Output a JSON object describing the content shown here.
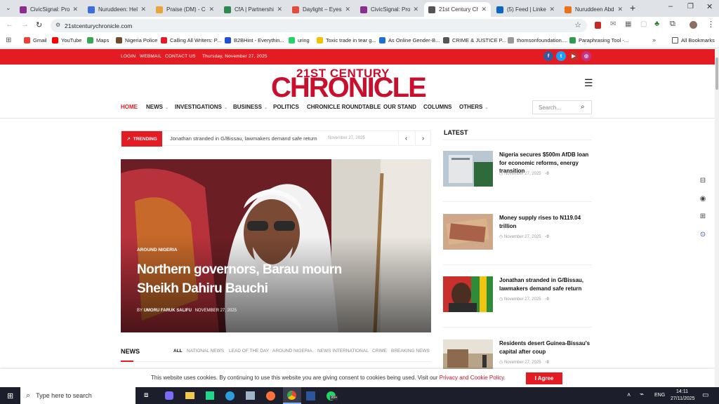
{
  "browser": {
    "tabs": [
      {
        "title": "CivicSignal: Proje",
        "color": "#8b2c8f"
      },
      {
        "title": "Nuruddeen: Help",
        "color": "#3b6de0"
      },
      {
        "title": "Praise (DM) - Coo",
        "color": "#e8a43a"
      },
      {
        "title": "CfA | Partnership:",
        "color": "#2c8a4e"
      },
      {
        "title": "Daylight – Eyes o",
        "color": "#e44b3a"
      },
      {
        "title": "CivicSignal: Proje",
        "color": "#8b2c8f"
      },
      {
        "title": "21st Century Chro",
        "color": "#555555"
      },
      {
        "title": "(5) Feed | LinkedIn",
        "color": "#0a66c2"
      },
      {
        "title": "Nuruddeen Abda",
        "color": "#e8731a"
      }
    ],
    "url": "21stcenturychronicle.com",
    "bookmarks": [
      {
        "label": "Gmail",
        "color": "#ea4335"
      },
      {
        "label": "YouTube",
        "color": "#ff0000"
      },
      {
        "label": "Maps",
        "color": "#34a853"
      },
      {
        "label": "Nigeria Police",
        "color": "#6d4c2a"
      },
      {
        "label": "Calling All Writers: P...",
        "color": "#e31b23"
      },
      {
        "label": "B2BHint - Everythin...",
        "color": "#2251d6"
      },
      {
        "label": "uring",
        "color": "#25d366"
      },
      {
        "label": "Toxic trade in tear g...",
        "color": "#f2c200"
      },
      {
        "label": "As Online Gender-B...",
        "color": "#1d6fd1"
      },
      {
        "label": "CRIME & JUSTICE P...",
        "color": "#555555"
      },
      {
        "label": "thomsonfoundation....",
        "color": "#999999"
      },
      {
        "label": "Paraphrasing Tool -...",
        "color": "#2a9d4f"
      }
    ],
    "all_bookmarks": "All Bookmarks"
  },
  "site": {
    "top_links": [
      "LOGIN",
      "WEBMAIL",
      "CONTACT US"
    ],
    "date": "Thursday, November 27, 2025",
    "logo_top": "21ST CENTURY",
    "logo_main": "CHRONICLE",
    "nav": [
      "HOME",
      "NEWS",
      "INVESTIGATIONS",
      "BUSINESS",
      "POLITICS",
      "CHRONICLE ROUNDTABLE",
      "OUR STAND",
      "COLUMNS",
      "OTHERS"
    ],
    "search_placeholder": "Search...",
    "trending_label": "TRENDING",
    "trending_text": "Jonathan stranded in G/Bissau, lawmakers demand safe return",
    "trending_date": "November 27, 2025",
    "hero": {
      "category": "AROUND NIGERIA",
      "title": "Northern governors, Barau mourn Sheikh Dahiru Bauchi",
      "byline_prefix": "BY",
      "author": "UMORU FARUK SALIFU",
      "date": "NOVEMBER 27, 2025"
    },
    "latest_heading": "LATEST",
    "latest": [
      {
        "title": "Nigeria secures $500m AfDB loan for economic reforms, energy transition",
        "date": "November 27, 2025",
        "comments": "0"
      },
      {
        "title": "Money supply rises to N119.04 trillion",
        "date": "November 27, 2025",
        "comments": "0"
      },
      {
        "title": "Jonathan stranded in G/Bissau, lawmakers demand safe return",
        "date": "November 27, 2025",
        "comments": "0"
      },
      {
        "title": "Residents desert Guinea-Bissau's capital after coup",
        "date": "November 27, 2025",
        "comments": "0"
      }
    ],
    "news_heading": "NEWS",
    "news_tabs": [
      "ALL",
      "NATIONAL NEWS",
      "LEAD OF THE DAY",
      "AROUND NIGERIA",
      "NEWS INTERNATIONAL",
      "CRIME",
      "BREAKING NEWS"
    ],
    "cookie_text": "This website uses cookies. By continuing to use this website you are giving consent to cookies being used. Visit our",
    "cookie_link": "Privacy and Cookie Policy",
    "cookie_button": "I Agree"
  },
  "taskbar": {
    "search_placeholder": "Type here to search",
    "lang": "ENG",
    "time": "14:11",
    "date": "27/11/2025",
    "badge": "99+"
  },
  "colors": {
    "brand_red": "#e31b23",
    "taskbar": "#1c1f2b"
  }
}
